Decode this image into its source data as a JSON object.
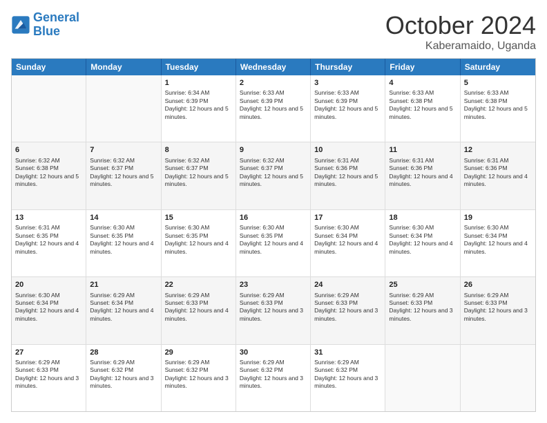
{
  "logo": {
    "line1": "General",
    "line2": "Blue"
  },
  "header": {
    "month": "October 2024",
    "location": "Kaberamaido, Uganda"
  },
  "dayHeaders": [
    "Sunday",
    "Monday",
    "Tuesday",
    "Wednesday",
    "Thursday",
    "Friday",
    "Saturday"
  ],
  "rows": [
    {
      "cells": [
        {
          "date": "",
          "info": ""
        },
        {
          "date": "",
          "info": ""
        },
        {
          "date": "1",
          "info": "Sunrise: 6:34 AM\nSunset: 6:39 PM\nDaylight: 12 hours and 5 minutes."
        },
        {
          "date": "2",
          "info": "Sunrise: 6:33 AM\nSunset: 6:39 PM\nDaylight: 12 hours and 5 minutes."
        },
        {
          "date": "3",
          "info": "Sunrise: 6:33 AM\nSunset: 6:39 PM\nDaylight: 12 hours and 5 minutes."
        },
        {
          "date": "4",
          "info": "Sunrise: 6:33 AM\nSunset: 6:38 PM\nDaylight: 12 hours and 5 minutes."
        },
        {
          "date": "5",
          "info": "Sunrise: 6:33 AM\nSunset: 6:38 PM\nDaylight: 12 hours and 5 minutes."
        }
      ]
    },
    {
      "cells": [
        {
          "date": "6",
          "info": "Sunrise: 6:32 AM\nSunset: 6:38 PM\nDaylight: 12 hours and 5 minutes."
        },
        {
          "date": "7",
          "info": "Sunrise: 6:32 AM\nSunset: 6:37 PM\nDaylight: 12 hours and 5 minutes."
        },
        {
          "date": "8",
          "info": "Sunrise: 6:32 AM\nSunset: 6:37 PM\nDaylight: 12 hours and 5 minutes."
        },
        {
          "date": "9",
          "info": "Sunrise: 6:32 AM\nSunset: 6:37 PM\nDaylight: 12 hours and 5 minutes."
        },
        {
          "date": "10",
          "info": "Sunrise: 6:31 AM\nSunset: 6:36 PM\nDaylight: 12 hours and 5 minutes."
        },
        {
          "date": "11",
          "info": "Sunrise: 6:31 AM\nSunset: 6:36 PM\nDaylight: 12 hours and 4 minutes."
        },
        {
          "date": "12",
          "info": "Sunrise: 6:31 AM\nSunset: 6:36 PM\nDaylight: 12 hours and 4 minutes."
        }
      ]
    },
    {
      "cells": [
        {
          "date": "13",
          "info": "Sunrise: 6:31 AM\nSunset: 6:35 PM\nDaylight: 12 hours and 4 minutes."
        },
        {
          "date": "14",
          "info": "Sunrise: 6:30 AM\nSunset: 6:35 PM\nDaylight: 12 hours and 4 minutes."
        },
        {
          "date": "15",
          "info": "Sunrise: 6:30 AM\nSunset: 6:35 PM\nDaylight: 12 hours and 4 minutes."
        },
        {
          "date": "16",
          "info": "Sunrise: 6:30 AM\nSunset: 6:35 PM\nDaylight: 12 hours and 4 minutes."
        },
        {
          "date": "17",
          "info": "Sunrise: 6:30 AM\nSunset: 6:34 PM\nDaylight: 12 hours and 4 minutes."
        },
        {
          "date": "18",
          "info": "Sunrise: 6:30 AM\nSunset: 6:34 PM\nDaylight: 12 hours and 4 minutes."
        },
        {
          "date": "19",
          "info": "Sunrise: 6:30 AM\nSunset: 6:34 PM\nDaylight: 12 hours and 4 minutes."
        }
      ]
    },
    {
      "cells": [
        {
          "date": "20",
          "info": "Sunrise: 6:30 AM\nSunset: 6:34 PM\nDaylight: 12 hours and 4 minutes."
        },
        {
          "date": "21",
          "info": "Sunrise: 6:29 AM\nSunset: 6:34 PM\nDaylight: 12 hours and 4 minutes."
        },
        {
          "date": "22",
          "info": "Sunrise: 6:29 AM\nSunset: 6:33 PM\nDaylight: 12 hours and 4 minutes."
        },
        {
          "date": "23",
          "info": "Sunrise: 6:29 AM\nSunset: 6:33 PM\nDaylight: 12 hours and 3 minutes."
        },
        {
          "date": "24",
          "info": "Sunrise: 6:29 AM\nSunset: 6:33 PM\nDaylight: 12 hours and 3 minutes."
        },
        {
          "date": "25",
          "info": "Sunrise: 6:29 AM\nSunset: 6:33 PM\nDaylight: 12 hours and 3 minutes."
        },
        {
          "date": "26",
          "info": "Sunrise: 6:29 AM\nSunset: 6:33 PM\nDaylight: 12 hours and 3 minutes."
        }
      ]
    },
    {
      "cells": [
        {
          "date": "27",
          "info": "Sunrise: 6:29 AM\nSunset: 6:33 PM\nDaylight: 12 hours and 3 minutes."
        },
        {
          "date": "28",
          "info": "Sunrise: 6:29 AM\nSunset: 6:32 PM\nDaylight: 12 hours and 3 minutes."
        },
        {
          "date": "29",
          "info": "Sunrise: 6:29 AM\nSunset: 6:32 PM\nDaylight: 12 hours and 3 minutes."
        },
        {
          "date": "30",
          "info": "Sunrise: 6:29 AM\nSunset: 6:32 PM\nDaylight: 12 hours and 3 minutes."
        },
        {
          "date": "31",
          "info": "Sunrise: 6:29 AM\nSunset: 6:32 PM\nDaylight: 12 hours and 3 minutes."
        },
        {
          "date": "",
          "info": ""
        },
        {
          "date": "",
          "info": ""
        }
      ]
    }
  ]
}
